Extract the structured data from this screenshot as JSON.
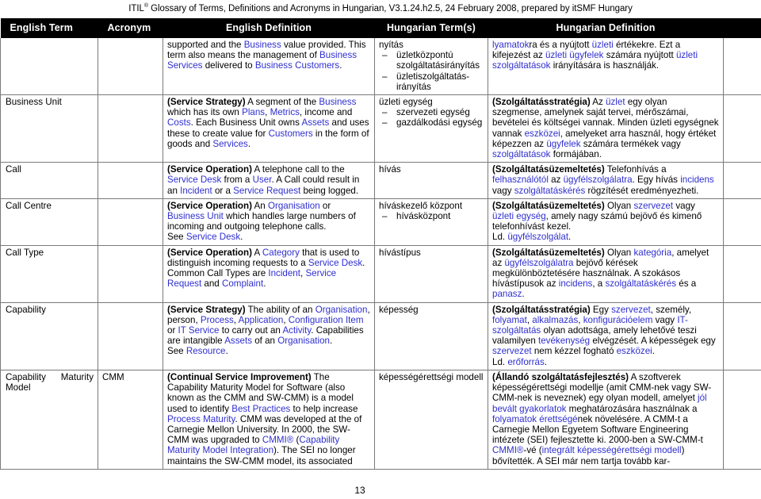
{
  "document": {
    "header_prefix": "ITIL",
    "header_registered_mark": "®",
    "header_rest": " Glossary of Terms, Definitions and Acronyms in Hungarian, V3.1.24.h2.5, 24 February 2008, prepared by itSMF Hungary",
    "page_number": "13",
    "link_color": "#2f2fd0",
    "header_bar_color": "#000000",
    "border_color": "#7a7a7a"
  },
  "table": {
    "columns": [
      {
        "key": "english_term",
        "label": "English Term"
      },
      {
        "key": "acronym",
        "label": "Acronym"
      },
      {
        "key": "english_definition",
        "label": "English Definition"
      },
      {
        "key": "hungarian_terms",
        "label": "Hungarian Term(s)"
      },
      {
        "key": "hungarian_definition",
        "label": "Hungarian Definition"
      },
      {
        "key": "extra",
        "label": ""
      }
    ],
    "rows": [
      {
        "english_term": "",
        "english_term_second": "",
        "acronym": "",
        "english_definition_html": "supported and the <span class=\"hl\">Business</span> value provided. This term also means the management of <span class=\"hl\">Business Services</span> delivered to <span class=\"hl\">Business Customers</span>.",
        "hungarian_term_main": "nyítás",
        "hungarian_term_items": [
          "üzletközpontú szolgáltatásirányítás",
          "üzletiszolgáltatás-irányítás"
        ],
        "hungarian_definition_html": "<span class=\"hl\">lyamatok</span>ra és a nyújtott <span class=\"hl\">üzleti</span> értékekre. Ezt a kifejezést az <span class=\"hl\">üzleti ügyfelek</span> számára nyújtott <span class=\"hl\">üzleti szolgáltatások</span> irányítására is használják.",
        "extra": ""
      },
      {
        "english_term": "Business Unit",
        "english_term_second": "",
        "acronym": "",
        "english_definition_html": "<span class=\"bold\">(Service Strategy)</span> A segment of the <span class=\"hl\">Business</span> which has its own <span class=\"hl\">Plans</span>, <span class=\"hl\">Metrics</span>, income and <span class=\"hl\">Costs</span>. Each Business Unit owns <span class=\"hl\">Assets</span> and uses these to create value for <span class=\"hl\">Customers</span> in the form of goods and <span class=\"hl\">Services</span>.",
        "hungarian_term_main": "üzleti egység",
        "hungarian_term_items": [
          "szervezeti egység",
          "gazdálkodási egység"
        ],
        "hungarian_definition_html": "<span class=\"bold\">(Szolgáltatásstratégia)</span> Az <span class=\"hl\">üzlet</span> egy olyan szegmense, amelynek saját tervei, mérőszámai, bevételei és költségei vannak. Minden üzleti egységnek vannak <span class=\"hl\">eszközei</span>, amelyeket arra használ, hogy értéket képezzen az <span class=\"hl\">ügyfelek</span> számára termékek vagy <span class=\"hl\">szolgáltatások</span> formájában.",
        "extra": ""
      },
      {
        "english_term": "Call",
        "english_term_second": "",
        "acronym": "",
        "english_definition_html": "<span class=\"bold\">(Service Operation)</span> A telephone call to the <span class=\"hl\">Service Desk</span> from a <span class=\"hl\">User</span>. A Call could result in an <span class=\"hl\">Incident</span> or a <span class=\"hl\">Service Request</span> being logged.",
        "hungarian_term_main": "hívás",
        "hungarian_term_items": [],
        "hungarian_definition_html": "<span class=\"bold\">(Szolgáltatásüzemeltetés)</span> Telefonhívás a <span class=\"hl\">felhasználótól</span> az <span class=\"hl\">ügyfélszolgálatra</span>. Egy hívás <span class=\"hl\">incidens</span> vagy <span class=\"hl\">szolgáltatáskérés</span> rögzítését eredményezheti.",
        "extra": ""
      },
      {
        "english_term": "Call Centre",
        "english_term_second": "",
        "acronym": "",
        "english_definition_html": "<span class=\"bold\">(Service Operation)</span> An <span class=\"hl\">Organisation</span> or <span class=\"hl\">Business Unit</span> which handles large numbers of incoming and outgoing telephone calls.<br>See <span class=\"hl\">Service Desk</span>.",
        "hungarian_term_main": "híváskezelő központ",
        "hungarian_term_items": [
          "hívásközpont"
        ],
        "hungarian_definition_html": "<span class=\"bold\">(Szolgáltatásüzemeltetés)</span> Olyan <span class=\"hl\">szervezet</span> vagy <span class=\"hl\">üzleti egység</span>, amely nagy számú bejövő és kimenő telefonhívást kezel.<br>Ld. <span class=\"hl\">ügyfélszolgálat</span>.",
        "extra": ""
      },
      {
        "english_term": "Call Type",
        "english_term_second": "",
        "acronym": "",
        "english_definition_html": "<span class=\"bold\">(Service Operation)</span> A <span class=\"hl\">Category</span> that is used to distinguish incoming requests to a <span class=\"hl\">Service Desk</span>. Common Call Types are <span class=\"hl\">Incident</span>, <span class=\"hl\">Service Request</span> and <span class=\"hl\">Complaint</span>.",
        "hungarian_term_main": "hívástípus",
        "hungarian_term_items": [],
        "hungarian_definition_html": "<span class=\"bold\">(Szolgáltatásüzemeltetés)</span> Olyan <span class=\"hl\">kategória</span>, amelyet az <span class=\"hl\">ügyfélszolgálatra</span> bejövő kérések megkülönböztetésére használnak. A szokásos hívástípusok az <span class=\"hl\">incidens</span>, a <span class=\"hl\">szolgáltatáskérés</span> és a <span class=\"hl\">panasz</span>.",
        "extra": ""
      },
      {
        "english_term": "Capability",
        "english_term_second": "",
        "acronym": "",
        "english_definition_html": "<span class=\"bold\">(Service Strategy)</span> The ability of an <span class=\"hl\">Organisation</span>, person, <span class=\"hl\">Process</span>, <span class=\"hl\">Application</span>, <span class=\"hl\">Configuration Item</span> or <span class=\"hl\">IT Service</span> to carry out an <span class=\"hl\">Activity</span>. Capabilities are intangible <span class=\"hl\">Assets</span> of an <span class=\"hl\">Organisation</span>.<br>See <span class=\"hl\">Resource</span>.",
        "hungarian_term_main": "képesség",
        "hungarian_term_items": [],
        "hungarian_definition_html": "<span class=\"bold\">(Szolgáltatásstratégia)</span> Egy <span class=\"hl\">szervezet</span>, személy, <span class=\"hl\">folyamat</span>, <span class=\"hl\">alkalmazás</span>, <span class=\"hl\">konfigurációelem</span> vagy <span class=\"hl\">IT-szolgáltatás</span> olyan adottsága, amely lehetővé teszi valamilyen <span class=\"hl\">tevékenység</span> elvégzését. A képességek egy <span class=\"hl\">szervezet</span> nem kézzel fogható <span class=\"hl\">eszközei</span>.<br>Ld. <span class=\"hl\">erőforrás</span>.",
        "extra": ""
      },
      {
        "english_term": "Capability",
        "english_term_second": "Maturity",
        "english_term_third": "Model",
        "acronym": "CMM",
        "english_definition_html": "<span class=\"bold\">(Continual Service Improvement)</span> The Capability Maturity Model for Software (also known as the CMM and SW-CMM) is a model used to identify <span class=\"hl\">Best Practices</span> to help increase <span class=\"hl\">Process Maturity</span>. CMM was developed at the of Carnegie Mellon University. In 2000, the SW-CMM was upgraded to <span class=\"hl\">CMMI®</span> (<span class=\"hl\">Capability Maturity Model Integration</span>). The SEI no longer maintains the SW-CMM model, its associated",
        "hungarian_term_main": "képességérettségi modell",
        "hungarian_term_items": [],
        "hungarian_definition_html": "<span class=\"bold\">(Állandó szolgáltatásfejlesztés)</span> A szoftverek képességérettségi modellje (amit CMM-nek vagy SW-CMM-nek is neveznek) egy olyan modell, amelyet <span class=\"hl\">jól bevált gyakorlatok</span> meghatározására használnak a <span class=\"hl\">folyamatok érettségé</span>nek növelésére. A CMM-t a Carnegie Mellon Egyetem Software Engineering intézete (SEI) fejlesztette ki. 2000-ben a SW-CMM-t <span class=\"hl\">CMMI®</span>-vé (<span class=\"hl\">integrált képességérettségi modell</span>) bővítették. A SEI már nem tartja tovább kar-",
        "extra": ""
      }
    ]
  }
}
